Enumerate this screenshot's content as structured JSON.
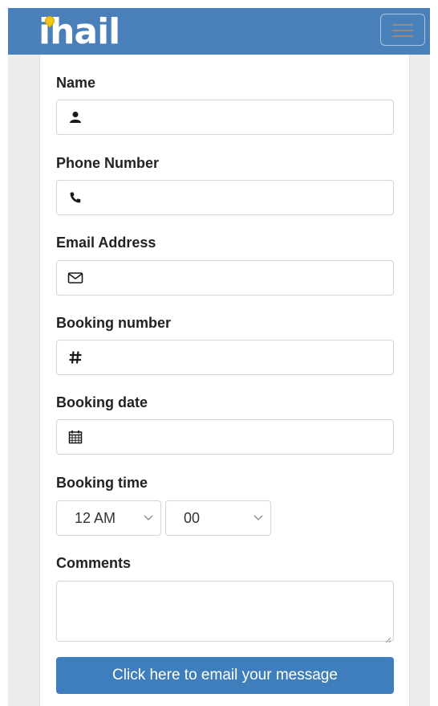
{
  "header": {
    "logo_text": "ihail",
    "menu_icon": "hamburger-icon",
    "brand_color": "#4a80b9"
  },
  "form": {
    "name": {
      "label": "Name",
      "icon": "user-icon",
      "value": ""
    },
    "phone": {
      "label": "Phone Number",
      "icon": "phone-icon",
      "value": ""
    },
    "email": {
      "label": "Email Address",
      "icon": "envelope-icon",
      "value": ""
    },
    "booking_number": {
      "label": "Booking number",
      "icon": "hash-icon",
      "value": ""
    },
    "booking_date": {
      "label": "Booking date",
      "icon": "calendar-icon",
      "value": ""
    },
    "booking_time": {
      "label": "Booking time",
      "hour": "12 AM",
      "minute": "00"
    },
    "comments": {
      "label": "Comments",
      "value": ""
    },
    "submit_label": "Click here to email your message",
    "button_color": "#3f7ebd"
  }
}
